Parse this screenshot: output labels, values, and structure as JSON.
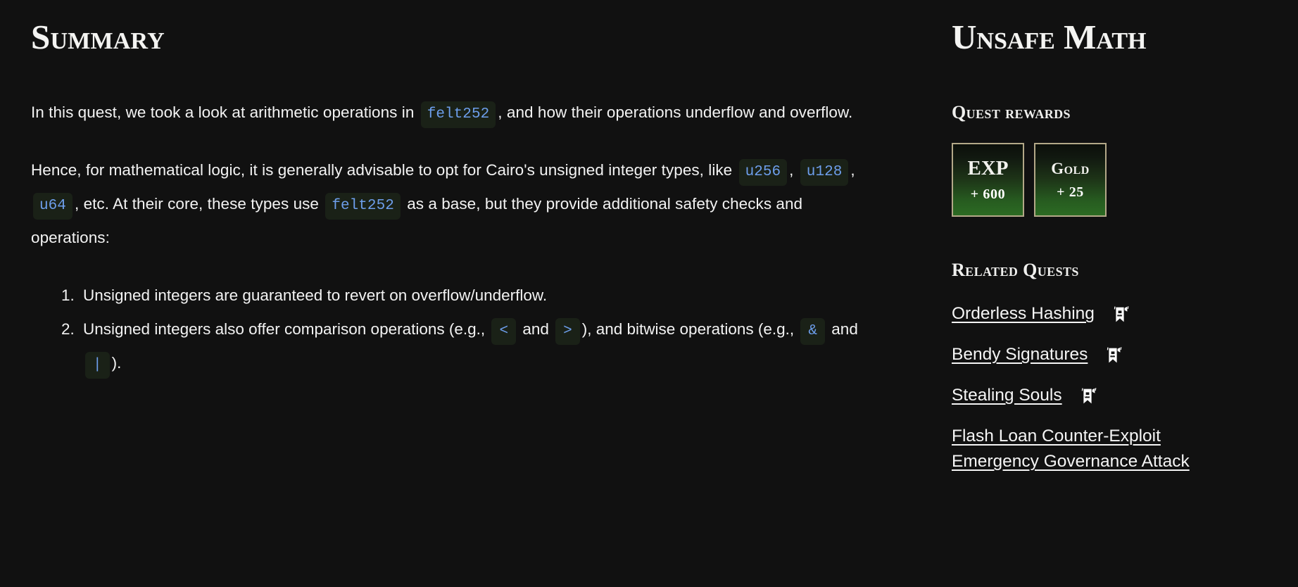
{
  "main": {
    "title": "Summary",
    "paragraph1": {
      "part1": "In this quest, we took a look at arithmetic operations in",
      "code1": "felt252",
      "part2": ", and how their operations underflow and overflow."
    },
    "paragraph2": {
      "part1": "Hence, for mathematical logic, it is generally advisable to opt for Cairo's unsigned integer types, like",
      "code1": "u256",
      "sep1": ",",
      "code2": "u128",
      "sep2": ",",
      "code3": "u64",
      "part2": ", etc. At their core, these types use",
      "code4": "felt252",
      "part3": "as a base, but they provide additional safety checks and operations:"
    },
    "list": {
      "item1": "Unsigned integers are guaranteed to revert on overflow/underflow.",
      "item2": {
        "part1": "Unsigned integers also offer comparison operations (e.g.,",
        "code1": "<",
        "part2": "and",
        "code2": ">",
        "part3": "), and bitwise operations (e.g.,",
        "code3": "&",
        "part4": "and",
        "code4": "|",
        "part5": ")."
      }
    }
  },
  "sidebar": {
    "title": "Unsafe Math",
    "rewards_heading": "Quest rewards",
    "rewards": [
      {
        "label": "EXP",
        "value": "+ 600"
      },
      {
        "label": "Gold",
        "value": "+ 25"
      }
    ],
    "related_heading": "Related Quests",
    "related_quests": [
      {
        "label": "Orderless Hashing",
        "icon": "banner-icon",
        "has_icon": true
      },
      {
        "label": "Bendy Signatures",
        "icon": "banner-icon",
        "has_icon": true
      },
      {
        "label": "Stealing Souls",
        "icon": "banner-icon",
        "has_icon": true
      },
      {
        "label": "Flash Loan Counter-Exploit",
        "has_icon": false
      },
      {
        "label": "Emergency Governance Attack",
        "has_icon": false
      }
    ]
  },
  "colors": {
    "background": "#111111",
    "text": "#f3f3f3",
    "code_text": "#6d9eeb",
    "code_bg": "#1a2117",
    "card_border": "#b3a888",
    "card_green": "#2c6b23"
  }
}
